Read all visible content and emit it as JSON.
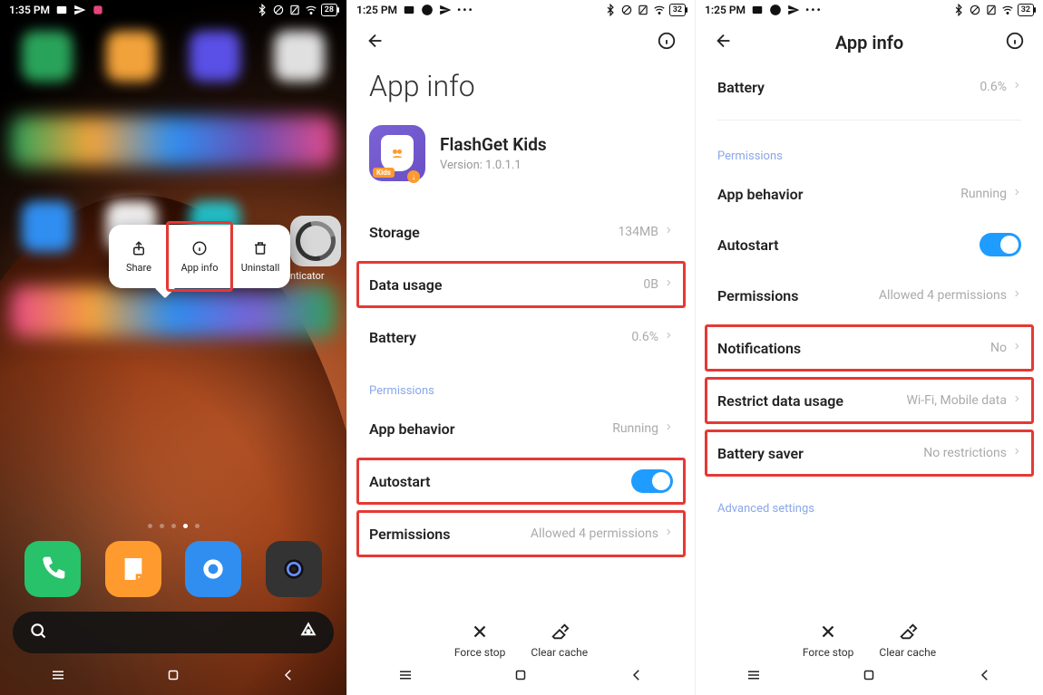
{
  "panel1": {
    "status": {
      "time": "1:35 PM",
      "battery": "28"
    },
    "popup": {
      "share": "Share",
      "appinfo": "App info",
      "uninstall": "Uninstall"
    },
    "authenticator_label": "nticator"
  },
  "panel2": {
    "status": {
      "time": "1:25 PM",
      "battery": "32"
    },
    "title": "App info",
    "app": {
      "name": "FlashGet Kids",
      "version": "Version: 1.0.1.1",
      "badge": "Kids"
    },
    "rows": {
      "storage": {
        "label": "Storage",
        "value": "134MB"
      },
      "data": {
        "label": "Data usage",
        "value": "0B"
      },
      "battery": {
        "label": "Battery",
        "value": "0.6%"
      }
    },
    "section_permissions": "Permissions",
    "rows2": {
      "behavior": {
        "label": "App behavior",
        "value": "Running"
      },
      "autostart": {
        "label": "Autostart"
      },
      "permissions": {
        "label": "Permissions",
        "value": "Allowed 4 permissions"
      }
    },
    "actions": {
      "force_stop": "Force stop",
      "clear_cache": "Clear cache"
    }
  },
  "panel3": {
    "status": {
      "time": "1:25 PM",
      "battery": "32"
    },
    "title": "App info",
    "rows": {
      "battery": {
        "label": "Battery",
        "value": "0.6%"
      }
    },
    "section_permissions": "Permissions",
    "rows2": {
      "behavior": {
        "label": "App behavior",
        "value": "Running"
      },
      "autostart": {
        "label": "Autostart"
      },
      "permissions": {
        "label": "Permissions",
        "value": "Allowed 4 permissions"
      },
      "notifications": {
        "label": "Notifications",
        "value": "No"
      },
      "restrict": {
        "label": "Restrict data usage",
        "value": "Wi-Fi, Mobile data"
      },
      "saver": {
        "label": "Battery saver",
        "value": "No restrictions"
      }
    },
    "section_advanced": "Advanced settings",
    "actions": {
      "force_stop": "Force stop",
      "clear_cache": "Clear cache"
    }
  }
}
